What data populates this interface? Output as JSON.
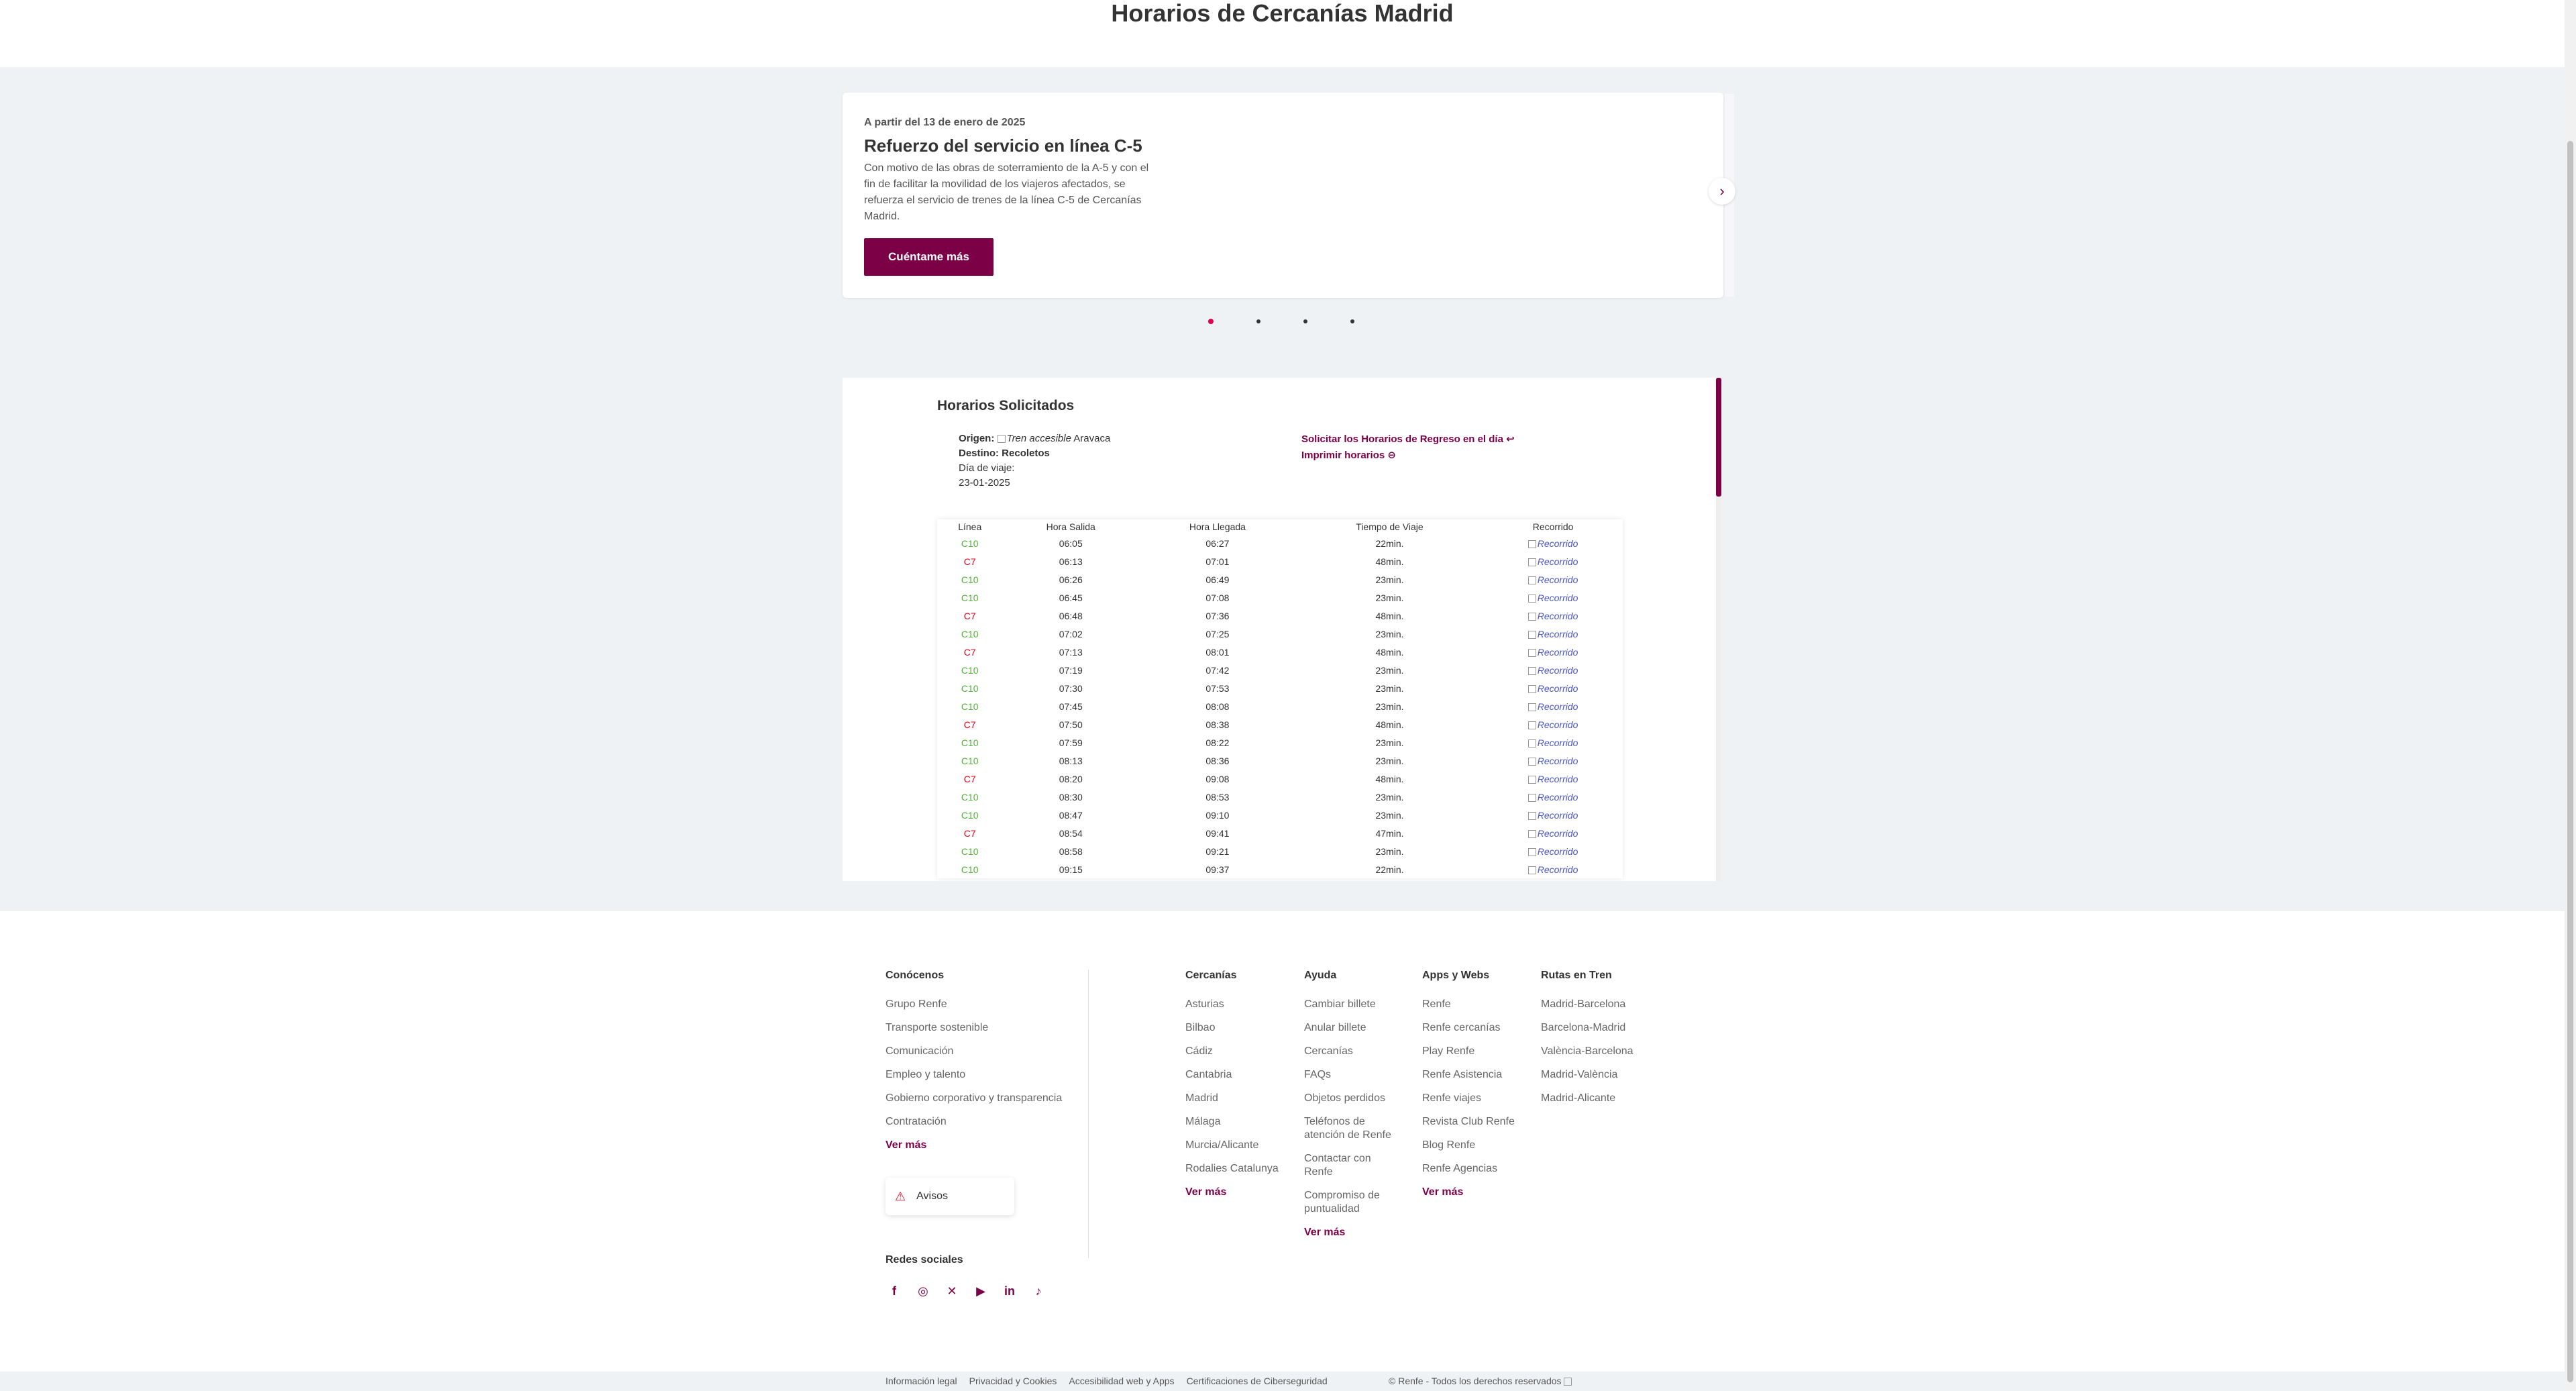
{
  "page_title": "Horarios de Cercanías Madrid",
  "promo": {
    "date": "A partir del 13 de enero de 2025",
    "title": "Refuerzo del servicio en línea C-5",
    "text": "Con motivo de las obras de soterramiento de la A-5 y con el fin de facilitar la movilidad de los viajeros afectados, se refuerza el servicio de trenes de la línea C-5 de Cercanías Madrid.",
    "button": "Cuéntame más",
    "next_icon": "chevron-right-icon"
  },
  "carousel_dots": 4,
  "schedule": {
    "heading": "Horarios Solicitados",
    "origin_label": "Origen:",
    "origin_img_alt": "Tren accesible",
    "origin_value": "Aravaca",
    "destination_label": "Destino:",
    "destination_value": "Recoletos",
    "day_label": "Día de viaje:",
    "day_value": "23-01-2025",
    "return_link": "Solicitar los Horarios de Regreso en el día",
    "print_link": "Imprimir horarios",
    "columns": [
      "Línea",
      "Hora Salida",
      "Hora Llegada",
      "Tiempo de Viaje",
      "Recorrido"
    ],
    "rows": [
      [
        "C10",
        "06:05",
        "06:27",
        "22min.",
        "Recorrido"
      ],
      [
        "C7",
        "06:13",
        "07:01",
        "48min.",
        "Recorrido"
      ],
      [
        "C10",
        "06:26",
        "06:49",
        "23min.",
        "Recorrido"
      ],
      [
        "C10",
        "06:45",
        "07:08",
        "23min.",
        "Recorrido"
      ],
      [
        "C7",
        "06:48",
        "07:36",
        "48min.",
        "Recorrido"
      ],
      [
        "C10",
        "07:02",
        "07:25",
        "23min.",
        "Recorrido"
      ],
      [
        "C7",
        "07:13",
        "08:01",
        "48min.",
        "Recorrido"
      ],
      [
        "C10",
        "07:19",
        "07:42",
        "23min.",
        "Recorrido"
      ],
      [
        "C10",
        "07:30",
        "07:53",
        "23min.",
        "Recorrido"
      ],
      [
        "C10",
        "07:45",
        "08:08",
        "23min.",
        "Recorrido"
      ],
      [
        "C7",
        "07:50",
        "08:38",
        "48min.",
        "Recorrido"
      ],
      [
        "C10",
        "07:59",
        "08:22",
        "23min.",
        "Recorrido"
      ],
      [
        "C10",
        "08:13",
        "08:36",
        "23min.",
        "Recorrido"
      ],
      [
        "C7",
        "08:20",
        "09:08",
        "48min.",
        "Recorrido"
      ],
      [
        "C10",
        "08:30",
        "08:53",
        "23min.",
        "Recorrido"
      ],
      [
        "C10",
        "08:47",
        "09:10",
        "23min.",
        "Recorrido"
      ],
      [
        "C7",
        "08:54",
        "09:41",
        "47min.",
        "Recorrido"
      ],
      [
        "C10",
        "08:58",
        "09:21",
        "23min.",
        "Recorrido"
      ],
      [
        "C10",
        "09:15",
        "09:37",
        "22min.",
        "Recorrido"
      ]
    ]
  },
  "footer": {
    "conocenos": {
      "title": "Conócenos",
      "links": [
        "Grupo Renfe",
        "Transporte sostenible",
        "Comunicación",
        "Empleo y talento",
        "Gobierno corporativo y transparencia",
        "Contratación"
      ],
      "more": "Ver más"
    },
    "cercanias": {
      "title": "Cercanías",
      "links": [
        "Asturias",
        "Bilbao",
        "Cádiz",
        "Cantabria",
        "Madrid",
        "Málaga",
        "Murcia/Alicante",
        "Rodalies Catalunya"
      ],
      "more": "Ver más"
    },
    "ayuda": {
      "title": "Ayuda",
      "links": [
        "Cambiar billete",
        "Anular billete",
        "Cercanías",
        "FAQs",
        "Objetos perdidos",
        "Teléfonos de atención de Renfe",
        "Contactar con Renfe",
        "Compromiso de puntualidad"
      ],
      "more": "Ver más"
    },
    "apps": {
      "title": "Apps y Webs",
      "links": [
        "Renfe",
        "Renfe cercanías",
        "Play Renfe",
        "Renfe Asistencia",
        "Renfe viajes",
        "Revista Club Renfe",
        "Blog Renfe",
        "Renfe Agencias"
      ],
      "more": "Ver más"
    },
    "rutas": {
      "title": "Rutas en Tren",
      "links": [
        "Madrid-Barcelona",
        "Barcelona-Madrid",
        "València-Barcelona",
        "Madrid-València",
        "Madrid-Alicante"
      ]
    },
    "avisos": "Avisos",
    "social_title": "Redes sociales",
    "social_icons": [
      "facebook-icon",
      "instagram-icon",
      "x-icon",
      "youtube-icon",
      "linkedin-icon",
      "tiktok-icon"
    ]
  },
  "legal": {
    "links": [
      "Información legal",
      "Privacidad y Cookies",
      "Accesibilidad web y Apps",
      "Certificaciones de Ciberseguridad"
    ],
    "copyright": "© Renfe - Todos los derechos reservados"
  },
  "colors": {
    "brand": "#7b0046",
    "c10": "#4fb135",
    "c7": "#e2001a",
    "background": "#eff2f5"
  }
}
